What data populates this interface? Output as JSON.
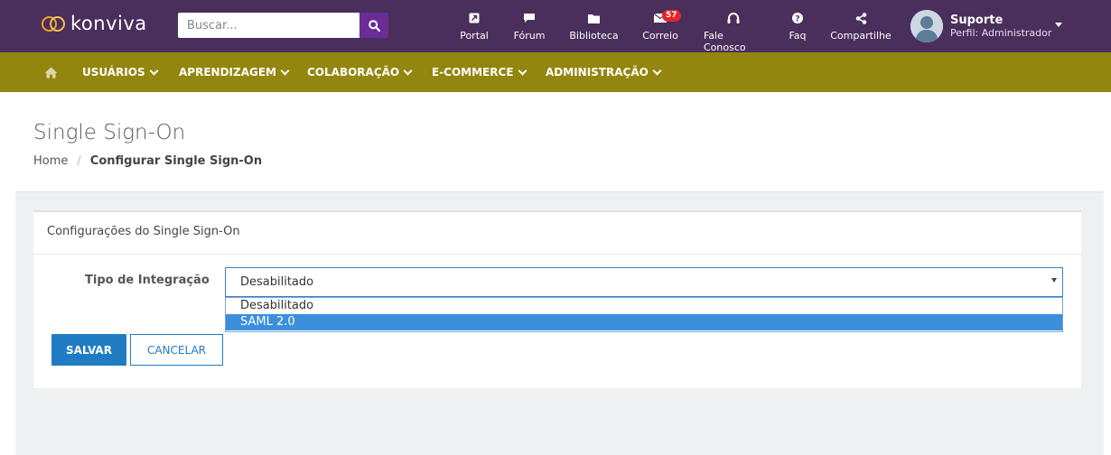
{
  "brand": {
    "name": "konviva"
  },
  "search": {
    "placeholder": "Buscar..."
  },
  "toolbar": [
    {
      "label": "Portal",
      "icon": "external-link-icon"
    },
    {
      "label": "Fórum",
      "icon": "comment-icon"
    },
    {
      "label": "Biblioteca",
      "icon": "folder-icon"
    },
    {
      "label": "Correio",
      "icon": "envelope-icon",
      "badge": "57"
    },
    {
      "label": "Fale Conosco",
      "icon": "headset-icon"
    },
    {
      "label": "Faq",
      "icon": "question-icon"
    },
    {
      "label": "Compartilhe",
      "icon": "share-icon"
    }
  ],
  "user": {
    "name": "Suporte",
    "role": "Perfil: Administrador"
  },
  "nav": {
    "home_icon": "home-icon",
    "items": [
      "USUÁRIOS",
      "APRENDIZAGEM",
      "COLABORAÇÃO",
      "E-COMMERCE",
      "ADMINISTRAÇÃO"
    ]
  },
  "page": {
    "title": "Single Sign-On",
    "breadcrumb": {
      "home": "Home",
      "current": "Configurar Single Sign-On"
    }
  },
  "panel": {
    "heading": "Configurações do Single Sign-On",
    "field_label": "Tipo de Integração",
    "select_value": "Desabilitado",
    "options": [
      "Desabilitado",
      "SAML 2.0"
    ],
    "highlighted_option": "SAML 2.0"
  },
  "buttons": {
    "save": "SALVAR",
    "cancel": "CANCELAR"
  },
  "colors": {
    "topbar": "#4a2f5c",
    "navbar": "#92860f",
    "primary": "#1f7cc2",
    "badge": "#e5252a",
    "search_button": "#6a2c95"
  }
}
